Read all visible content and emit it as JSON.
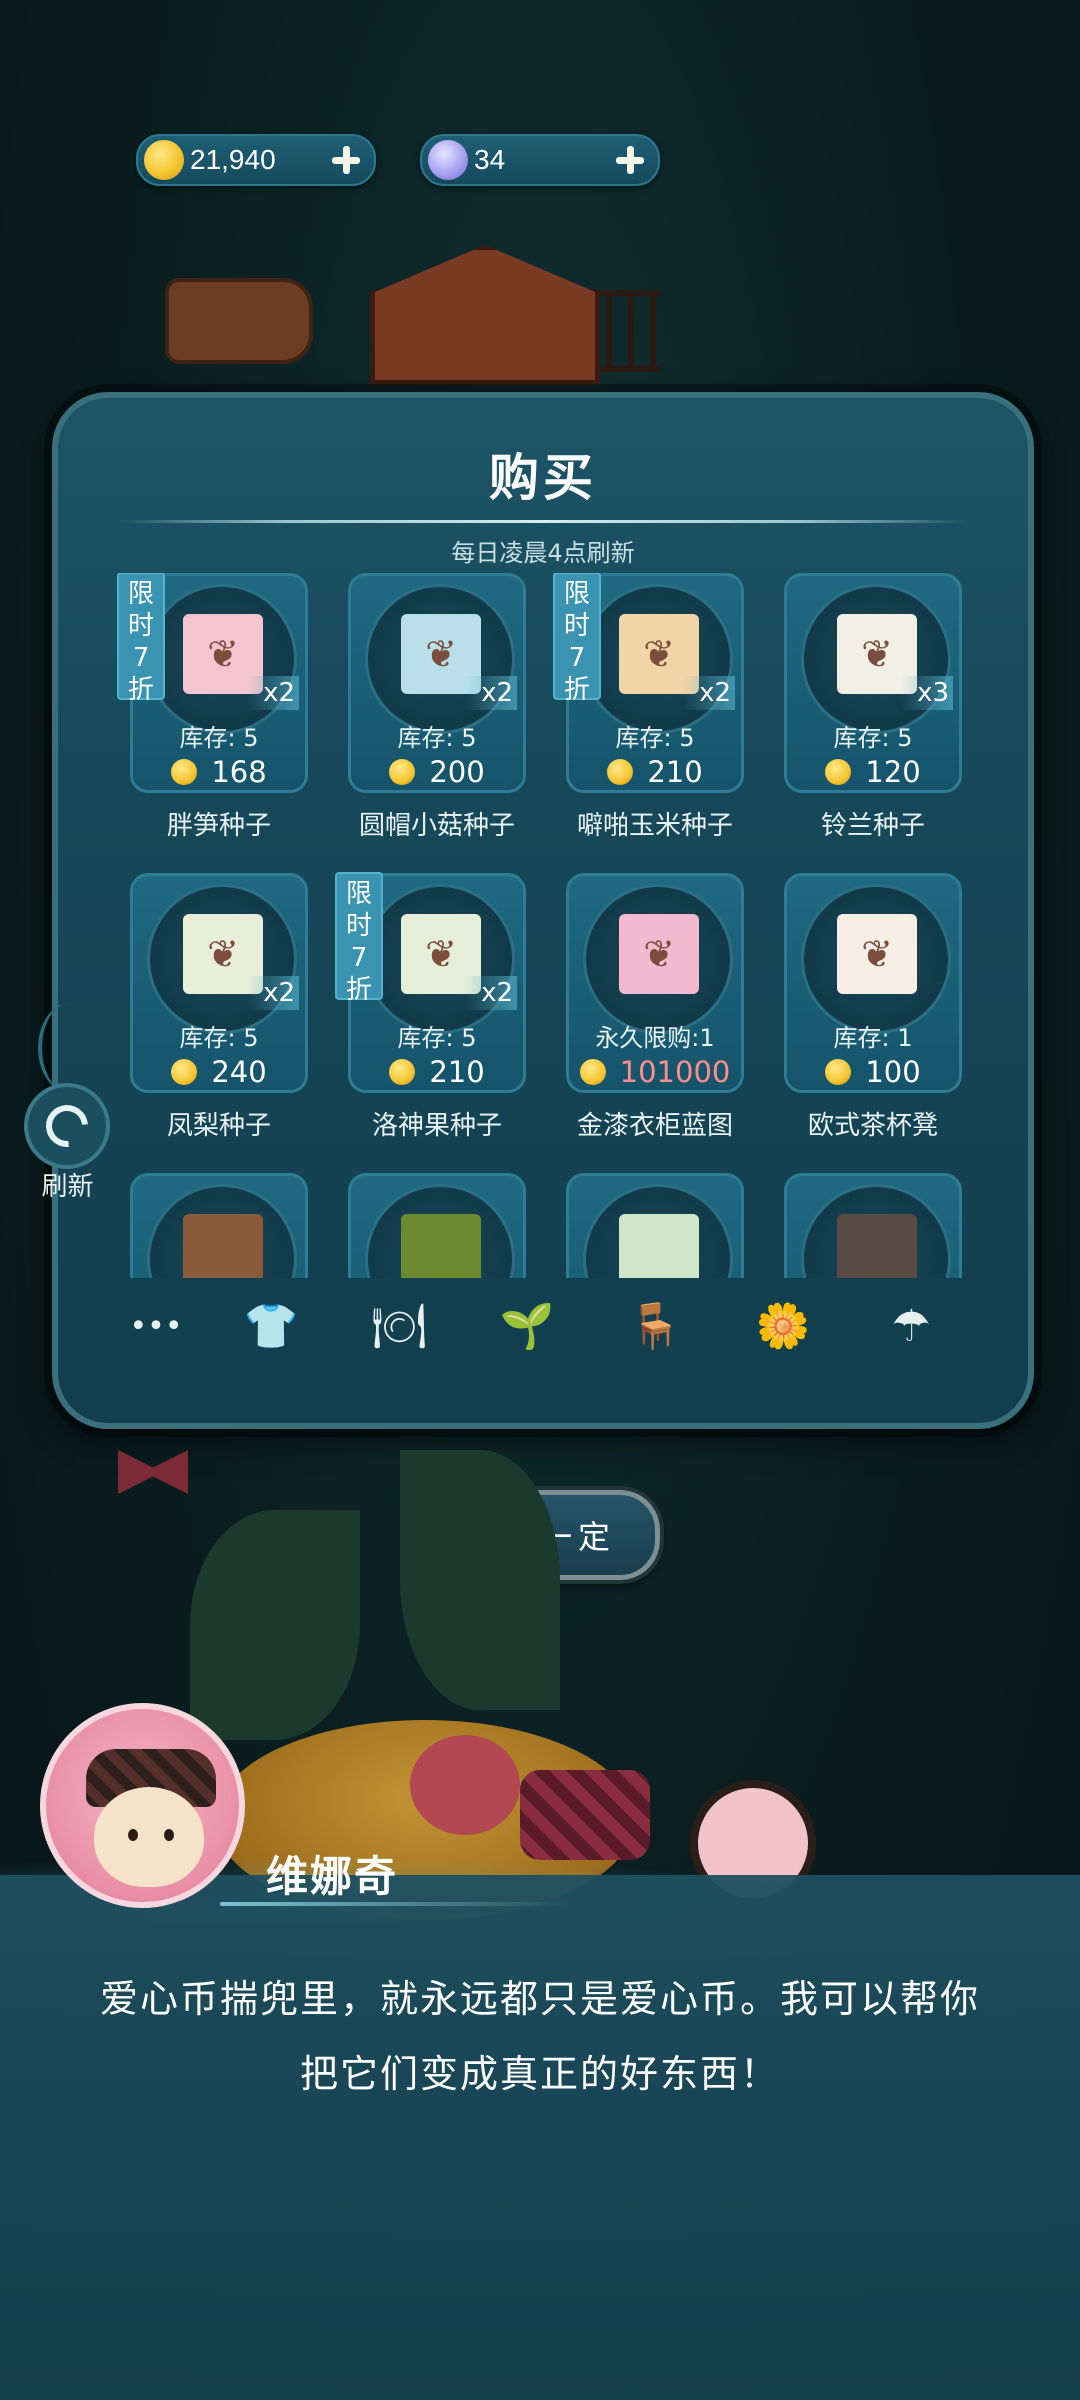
{
  "currency": {
    "coins": "21,940",
    "moons": "34",
    "coin_icon": "gold-coin-icon",
    "moon_icon": "moon-token-icon"
  },
  "shop": {
    "title": "购买",
    "subtitle": "每日凌晨4点刷新",
    "badge_text": [
      "限",
      "时",
      "7",
      "折"
    ],
    "items": [
      {
        "name": "胖笋种子",
        "stock": "库存: 5",
        "price": "168",
        "qty": "x2",
        "badge": true,
        "pack_color": "#f3c6cf",
        "icon": "bamboo-shoot-seed-icon"
      },
      {
        "name": "圆帽小菇种子",
        "stock": "库存: 5",
        "price": "200",
        "qty": "x2",
        "badge": false,
        "pack_color": "#b9e0ea",
        "icon": "mushroom-seed-icon"
      },
      {
        "name": "噼啪玉米种子",
        "stock": "库存: 5",
        "price": "210",
        "qty": "x2",
        "badge": true,
        "pack_color": "#f2d4a7",
        "icon": "corn-seed-icon"
      },
      {
        "name": "铃兰种子",
        "stock": "库存: 5",
        "price": "120",
        "qty": "x3",
        "badge": false,
        "pack_color": "#f1efe6",
        "icon": "lily-of-valley-seed-icon"
      },
      {
        "name": "凤梨种子",
        "stock": "库存: 5",
        "price": "240",
        "qty": "x2",
        "badge": false,
        "pack_color": "#e8eed8",
        "icon": "pineapple-seed-icon"
      },
      {
        "name": "洛神果种子",
        "stock": "库存: 5",
        "price": "210",
        "qty": "x2",
        "badge": true,
        "pack_color": "#e4eed8",
        "icon": "roselle-seed-icon"
      },
      {
        "name": "金漆衣柜蓝图",
        "stock": "永久限购:1",
        "price": "101000",
        "qty": "",
        "badge": false,
        "pack_color": "#f3b9cf",
        "icon": "wardrobe-blueprint-icon",
        "price_red": true
      },
      {
        "name": "欧式茶杯凳",
        "stock": "库存: 1",
        "price": "100",
        "qty": "",
        "badge": false,
        "pack_color": "#f6efe6",
        "icon": "teacup-stool-icon"
      }
    ],
    "tabs": [
      "more-icon",
      "clothing-icon",
      "food-icon",
      "seed-bag-icon",
      "furniture-icon",
      "plant-icon",
      "umbrella-icon"
    ]
  },
  "side": {
    "refresh_label": "刷新"
  },
  "next_button": "下次一定",
  "dialog": {
    "speaker": "维娜奇",
    "line1": "爱心币揣兜里，就永远都只是爱心币。我可以帮你",
    "line2": "把它们变成真正的好东西！"
  },
  "colors": {
    "panel": "#17495a",
    "card": "#1f6a82",
    "badge": "#3b93b2",
    "price_red": "#ff8d8d",
    "coin": "#f4c531"
  }
}
